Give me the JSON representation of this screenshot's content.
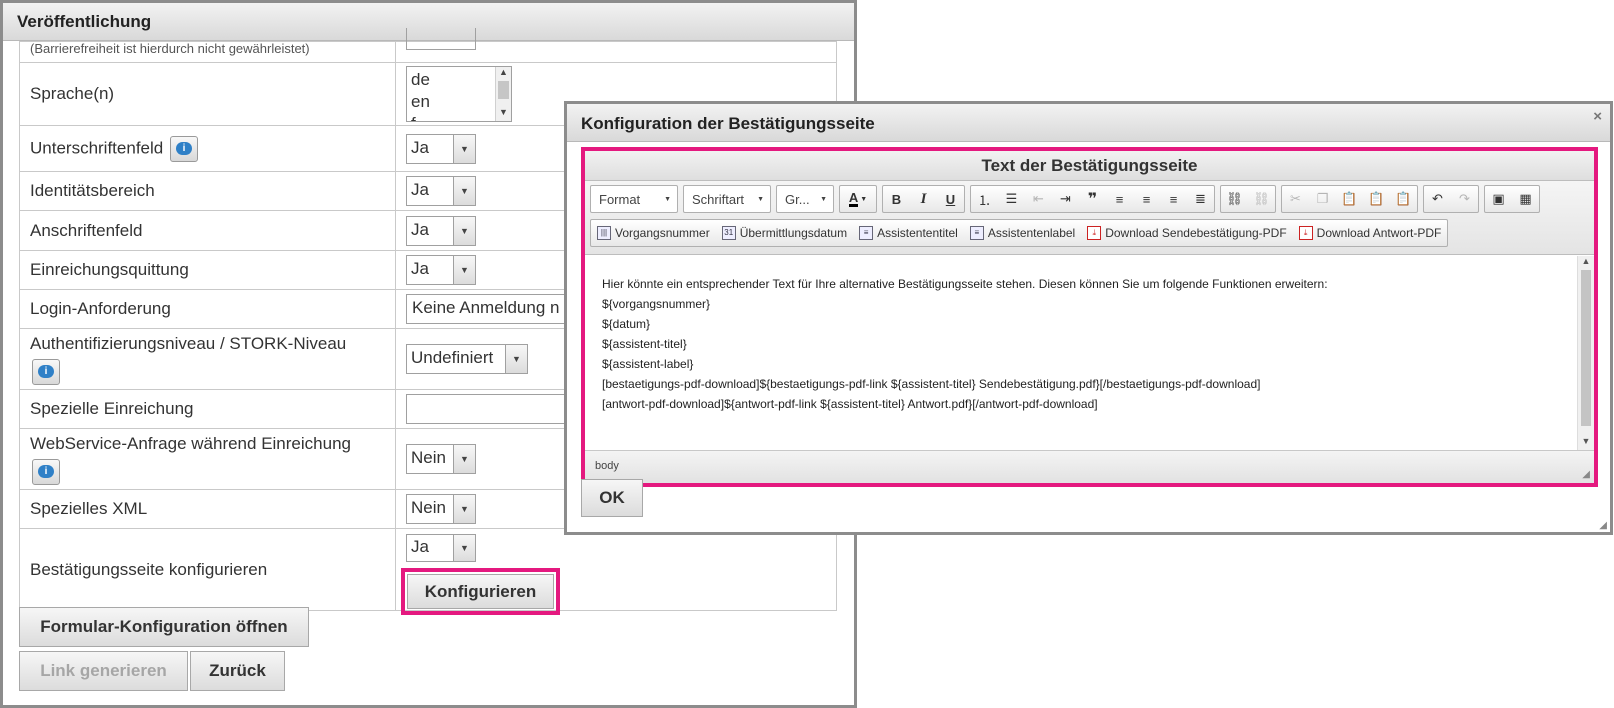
{
  "panel": {
    "title": "Veröffentlichung",
    "rows": [
      {
        "label": "",
        "note": "(Barrierefreiheit ist hierdurch nicht gewährleistet)"
      },
      {
        "label": "Sprache(n)",
        "options": [
          "de",
          "en",
          "f"
        ]
      },
      {
        "label": "Unterschriftenfeld",
        "value": "Ja"
      },
      {
        "label": "Identitätsbereich",
        "value": "Ja"
      },
      {
        "label": "Anschriftenfeld",
        "value": "Ja"
      },
      {
        "label": "Einreichungsquittung",
        "value": "Ja"
      },
      {
        "label": "Login-Anforderung",
        "value": "Keine Anmeldung n"
      },
      {
        "label": "Authentifizierungsniveau / STORK-Niveau",
        "value": "Undefiniert"
      },
      {
        "label": "Spezielle Einreichung",
        "value": ""
      },
      {
        "label": "WebService-Anfrage während Einreichung",
        "value": "Nein"
      },
      {
        "label": "Spezielles XML",
        "value": "Nein"
      },
      {
        "label": "Bestätigungsseite konfigurieren",
        "value": "Ja",
        "button": "Konfigurieren"
      }
    ],
    "buttons": {
      "form_config": "Formular-Konfiguration öffnen",
      "generate_link": "Link generieren",
      "back": "Zurück"
    }
  },
  "dialog": {
    "title": "Konfiguration der Bestätigungsseite",
    "close": "×",
    "editor": {
      "title": "Text der Bestätigungsseite",
      "combos": {
        "format": "Format",
        "font": "Schriftart",
        "size": "Gr..."
      },
      "custom_buttons": {
        "vorgangsnummer": "Vorgangsnummer",
        "uebermittlungsdatum": "Übermittlungsdatum",
        "assistententitel": "Assistententitel",
        "assistentenlabel": "Assistentenlabel",
        "download_sende": "Download Sendebestätigung-PDF",
        "download_antwort": "Download Antwort-PDF"
      },
      "content": [
        "Hier könnte ein entsprechender Text für Ihre alternative Bestätigungsseite stehen. Diesen können Sie um folgende Funktionen erweitern:",
        "${vorgangsnummer}",
        "${datum}",
        "${assistent-titel}",
        "${assistent-label}",
        "[bestaetigungs-pdf-download]${bestaetigungs-pdf-link ${assistent-titel} Sendebestätigung.pdf}[/bestaetigungs-pdf-download]",
        "[antwort-pdf-download]${antwort-pdf-link ${assistent-titel} Antwort.pdf}[/antwort-pdf-download]"
      ],
      "status": "body"
    },
    "ok": "OK"
  },
  "colors": {
    "highlight": "#e4197f",
    "help_icon": "#2f80c7"
  }
}
